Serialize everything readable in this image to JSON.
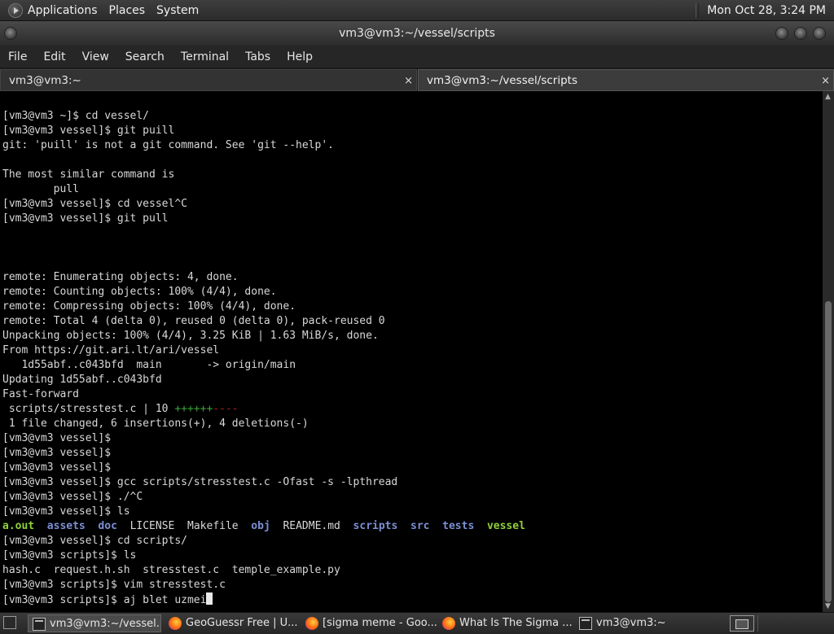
{
  "top_panel": {
    "menus": [
      "Applications",
      "Places",
      "System"
    ],
    "clock": "Mon Oct 28,  3:24 PM"
  },
  "window": {
    "title": "vm3@vm3:~/vessel/scripts"
  },
  "menubar": [
    "File",
    "Edit",
    "View",
    "Search",
    "Terminal",
    "Tabs",
    "Help"
  ],
  "tabs": [
    {
      "label": "vm3@vm3:~"
    },
    {
      "label": "vm3@vm3:~/vessel/scripts"
    }
  ],
  "tab_close_glyph": "×",
  "terminal": {
    "lines": [
      "[vm3@vm3 ~]$ cd vessel/",
      "[vm3@vm3 vessel]$ git puill",
      "git: 'puill' is not a git command. See 'git --help'.",
      "",
      "The most similar command is",
      "        pull",
      "[vm3@vm3 vessel]$ cd vessel^C",
      "[vm3@vm3 vessel]$ git pull",
      "",
      "",
      "",
      "remote: Enumerating objects: 4, done.",
      "remote: Counting objects: 100% (4/4), done.",
      "remote: Compressing objects: 100% (4/4), done.",
      "remote: Total 4 (delta 0), reused 0 (delta 0), pack-reused 0",
      "Unpacking objects: 100% (4/4), 3.25 KiB | 1.63 MiB/s, done.",
      "From https://git.ari.lt/ari/vessel",
      "   1d55abf..c043bfd  main       -> origin/main",
      "Updating 1d55abf..c043bfd",
      "Fast-forward"
    ],
    "diffstat": {
      "file": " scripts/stresstest.c | 10 ",
      "plus": "++++++",
      "minus": "----"
    },
    "lines2": [
      " 1 file changed, 6 insertions(+), 4 deletions(-)",
      "[vm3@vm3 vessel]$",
      "[vm3@vm3 vessel]$",
      "[vm3@vm3 vessel]$",
      "[vm3@vm3 vessel]$ gcc scripts/stresstest.c -Ofast -s -lpthread",
      "[vm3@vm3 vessel]$ ./^C",
      "[vm3@vm3 vessel]$ ls"
    ],
    "ls_output": [
      {
        "name": "a.out",
        "kind": "exe"
      },
      {
        "name": "assets",
        "kind": "dir"
      },
      {
        "name": "doc",
        "kind": "dir"
      },
      {
        "name": "LICENSE",
        "kind": "file"
      },
      {
        "name": "Makefile",
        "kind": "file"
      },
      {
        "name": "obj",
        "kind": "dir"
      },
      {
        "name": "README.md",
        "kind": "file"
      },
      {
        "name": "scripts",
        "kind": "dir"
      },
      {
        "name": "src",
        "kind": "dir"
      },
      {
        "name": "tests",
        "kind": "dir"
      },
      {
        "name": "vessel",
        "kind": "exe"
      }
    ],
    "lines3": [
      "[vm3@vm3 vessel]$ cd scripts/",
      "[vm3@vm3 scripts]$ ls",
      "hash.c  request.h.sh  stresstest.c  temple_example.py",
      "[vm3@vm3 scripts]$ vim stresstest.c"
    ],
    "prompt_line": "[vm3@vm3 scripts]$ aj blet uzmei"
  },
  "taskbar": {
    "items": [
      {
        "label": "vm3@vm3:~/vessel...",
        "icon": "terminal-icon",
        "active": true
      },
      {
        "label": "GeoGuessr Free | U...",
        "icon": "firefox-icon",
        "active": false
      },
      {
        "label": "[sigma meme - Goo...",
        "icon": "firefox-icon",
        "active": false
      },
      {
        "label": "What Is The Sigma ...",
        "icon": "firefox-icon",
        "active": false
      },
      {
        "label": "vm3@vm3:~",
        "icon": "terminal-icon",
        "active": false
      }
    ]
  },
  "colors": {
    "dir": "#7b8fd4",
    "exe": "#8fd13a",
    "plus": "#3aa33a",
    "minus": "#b02020"
  }
}
